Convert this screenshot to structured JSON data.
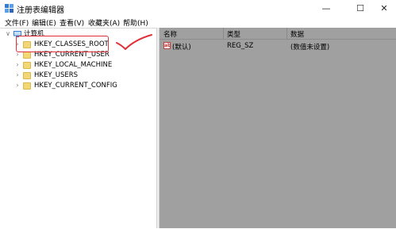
{
  "window": {
    "title": "注册表编辑器",
    "minimize_glyph": "—",
    "maximize_glyph": "☐",
    "close_glyph": "✕"
  },
  "menu": [
    "文件(F)",
    "编辑(E)",
    "查看(V)",
    "收藏夹(A)",
    "帮助(H)"
  ],
  "tree": {
    "root_label": "计算机",
    "root_expander": "∨",
    "child_expander": "›",
    "items": [
      {
        "label": "HKEY_CLASSES_ROOT",
        "highlighted": true
      },
      {
        "label": "HKEY_CURRENT_USER"
      },
      {
        "label": "HKEY_LOCAL_MACHINE"
      },
      {
        "label": "HKEY_USERS"
      },
      {
        "label": "HKEY_CURRENT_CONFIG"
      }
    ]
  },
  "values_pane": {
    "columns": [
      "名称",
      "类型",
      "数据"
    ],
    "rows": [
      {
        "icon": "ab",
        "name": "(默认)",
        "type": "REG_SZ",
        "data": "(数值未设置)"
      }
    ]
  },
  "colors": {
    "annotation": "#e0313a",
    "right_pane_bg": "#a0a0a0",
    "folder": "#f2d774"
  }
}
